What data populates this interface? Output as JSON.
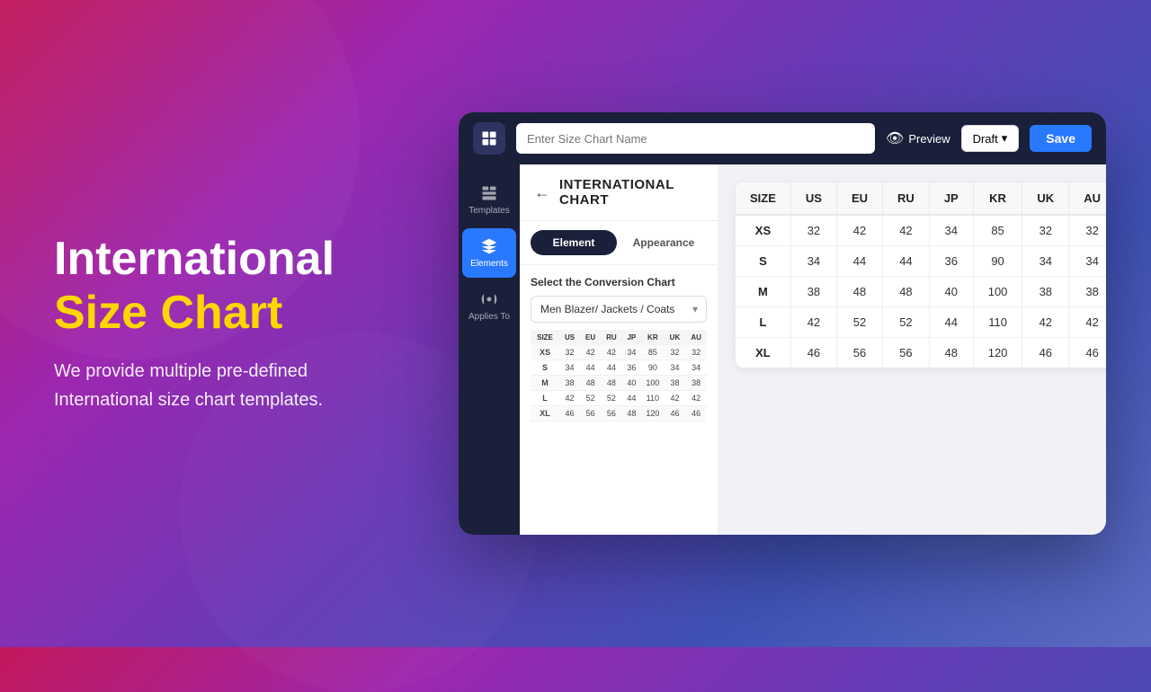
{
  "background": {
    "gradient": "purple-pink"
  },
  "left": {
    "heading_white": "International",
    "heading_yellow": "Size Chart",
    "description": "We provide multiple pre-defined International size chart templates."
  },
  "topbar": {
    "input_placeholder": "Enter Size Chart Name",
    "preview_label": "Preview",
    "draft_label": "Draft",
    "save_label": "Save"
  },
  "sidebar": {
    "items": [
      {
        "id": "templates",
        "label": "Templates",
        "active": false
      },
      {
        "id": "elements",
        "label": "Elements",
        "active": true
      },
      {
        "id": "applies-to",
        "label": "Applies To",
        "active": false
      }
    ]
  },
  "panel": {
    "chart_title": "INTERNATIONAL CHART",
    "tabs": [
      {
        "id": "element",
        "label": "Element",
        "active": true
      },
      {
        "id": "appearance",
        "label": "Appearance",
        "active": false
      }
    ],
    "conversion_label": "Select the Conversion Chart",
    "conversion_value": "Men Blazer/ Jackets / Coats",
    "table": {
      "headers": [
        "SIZE",
        "US",
        "EU",
        "RU",
        "JP",
        "KR",
        "UK",
        "AU"
      ],
      "rows": [
        [
          "XS",
          "32",
          "42",
          "42",
          "34",
          "85",
          "32",
          "32"
        ],
        [
          "S",
          "34",
          "44",
          "44",
          "36",
          "90",
          "34",
          "34"
        ],
        [
          "M",
          "38",
          "48",
          "48",
          "40",
          "100",
          "38",
          "38"
        ],
        [
          "L",
          "42",
          "52",
          "52",
          "44",
          "110",
          "42",
          "42"
        ],
        [
          "XL",
          "46",
          "56",
          "56",
          "48",
          "120",
          "46",
          "46"
        ]
      ]
    }
  },
  "preview": {
    "table": {
      "headers": [
        "SIZE",
        "US",
        "EU",
        "RU",
        "JP",
        "KR",
        "UK",
        "AU"
      ],
      "rows": [
        [
          "XS",
          "32",
          "42",
          "42",
          "34",
          "85",
          "32",
          "32"
        ],
        [
          "S",
          "34",
          "44",
          "44",
          "36",
          "90",
          "34",
          "34"
        ],
        [
          "M",
          "38",
          "48",
          "48",
          "40",
          "100",
          "38",
          "38"
        ],
        [
          "L",
          "42",
          "52",
          "52",
          "44",
          "110",
          "42",
          "42"
        ],
        [
          "XL",
          "46",
          "56",
          "56",
          "48",
          "120",
          "46",
          "46"
        ]
      ]
    }
  }
}
